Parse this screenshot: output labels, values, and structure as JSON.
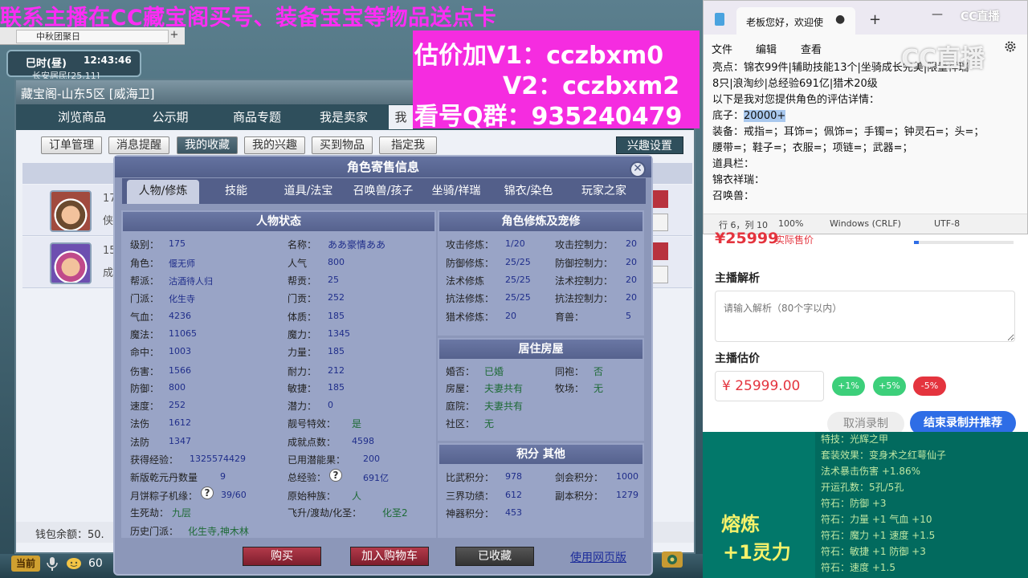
{
  "game": {
    "tab_title": "中秋团聚日",
    "time_label": "巳时(昼)",
    "time_value": "12:43:46",
    "location": "长安居民[25,11]",
    "window_title": "藏宝阁-山东5区 [威海卫]",
    "nav_tabs": [
      "浏览商品",
      "公示期",
      "商品专题",
      "我是卖家",
      "我"
    ],
    "sub_tabs": [
      "订单管理",
      "消息提醒",
      "我的收藏",
      "我的兴趣",
      "买到物品",
      "指定我"
    ],
    "interest_settings": "兴趣设置",
    "row1_snippet": "17",
    "row1_sub": "侠",
    "row2_snippet": "15",
    "row2_sub": "成",
    "wallet_label": "钱包余额：50.",
    "current_label": "当前",
    "level_num": "60"
  },
  "promo": {
    "line1": "联系主播在CC藏宝阁买号、装备宝宝等物品送点卡",
    "line2": "估价加V1：cczbxm0",
    "line3": "V2：cczbxm2",
    "line4": "看号Q群：935240479"
  },
  "modal": {
    "title": "角色寄售信息",
    "close": "✕",
    "tabs": [
      "人物/修炼",
      "技能",
      "道具/法宝",
      "召唤兽/孩子",
      "坐骑/祥瑞",
      "锦衣/染色",
      "玩家之家"
    ],
    "panel_status_title": "人物状态",
    "status_left": [
      {
        "label": "级别：",
        "value": "175"
      },
      {
        "label": "角色：",
        "value": "偃无师"
      },
      {
        "label": "帮派：",
        "value": "沽酒待人归"
      },
      {
        "label": "门派：",
        "value": "化生寺"
      },
      {
        "label": "气血：",
        "value": "4236"
      },
      {
        "label": "魔法：",
        "value": "11065"
      },
      {
        "label": "命中：",
        "value": "1003"
      },
      {
        "label": "伤害：",
        "value": "1566"
      },
      {
        "label": "防御：",
        "value": "800"
      },
      {
        "label": "速度：",
        "value": "252"
      },
      {
        "label": "法伤",
        "value": "1612"
      },
      {
        "label": "法防",
        "value": "1347"
      },
      {
        "label": "获得经验：",
        "value": "1325574429"
      },
      {
        "label": "新版乾元丹数量",
        "value": "9"
      },
      {
        "label": "月饼粽子机缘：",
        "value": "39/60"
      },
      {
        "label": "生死劫：",
        "value": "九层"
      },
      {
        "label": "历史门派：",
        "value": "化生寺,神木林"
      }
    ],
    "status_right": [
      {
        "label": "名称：",
        "value": "ああ豪情ああ"
      },
      {
        "label": "人气",
        "value": "800"
      },
      {
        "label": "帮贡：",
        "value": "25"
      },
      {
        "label": "门贡：",
        "value": "252"
      },
      {
        "label": "体质：",
        "value": "185"
      },
      {
        "label": "魔力：",
        "value": "1345"
      },
      {
        "label": "力量：",
        "value": "185"
      },
      {
        "label": "耐力：",
        "value": "212"
      },
      {
        "label": "敏捷：",
        "value": "185"
      },
      {
        "label": "潜力：",
        "value": "0"
      },
      {
        "label": "靓号特效：",
        "value": "是"
      },
      {
        "label": "成就点数：",
        "value": "4598"
      },
      {
        "label": "已用潜能果：",
        "value": "200"
      },
      {
        "label": "总经验：",
        "value": "691亿"
      },
      {
        "label": "原始种族：",
        "value": "人"
      },
      {
        "label": "飞升/渡劫/化圣：",
        "value": "化圣2"
      }
    ],
    "panel_cultivation_title": "角色修炼及宠修",
    "cultivation": [
      {
        "label": "攻击修炼：",
        "value": "1/20",
        "label2": "攻击控制力：",
        "value2": "20"
      },
      {
        "label": "防御修炼：",
        "value": "25/25",
        "label2": "防御控制力：",
        "value2": "20"
      },
      {
        "label": "法术修炼",
        "value": "25/25",
        "label2": "法术控制力：",
        "value2": "20"
      },
      {
        "label": "抗法修炼：",
        "value": "25/25",
        "label2": "抗法控制力：",
        "value2": "20"
      },
      {
        "label": "猎术修炼：",
        "value": "20",
        "label2": "育兽：",
        "value2": "5"
      }
    ],
    "panel_house_title": "居住房屋",
    "house": [
      {
        "label": "婚否：",
        "value": "已婚",
        "label2": "同袍：",
        "value2": "否"
      },
      {
        "label": "房屋：",
        "value": "夫妻共有",
        "label2": "牧场：",
        "value2": "无"
      },
      {
        "label": "庭院：",
        "value": "夫妻共有"
      },
      {
        "label": "社区：",
        "value": "无"
      }
    ],
    "panel_points_title": "积分 其他",
    "points": [
      {
        "label": "比武积分：",
        "value": "978",
        "label2": "剑会积分：",
        "value2": "1000"
      },
      {
        "label": "三界功绩：",
        "value": "612",
        "label2": "副本积分：",
        "value2": "1279"
      },
      {
        "label": "神器积分：",
        "value": "453"
      }
    ],
    "help_glyph": "?",
    "buttons": {
      "buy": "购买",
      "cart": "加入购物车",
      "collected": "已收藏",
      "web": "使用网页版"
    }
  },
  "notepad": {
    "tab_title": "老板您好，欢迎使",
    "tab_dot": "●",
    "add_tab": "+",
    "minimize": "—",
    "menus": [
      "文件",
      "编辑",
      "查看"
    ],
    "lines": [
      "亮点：锦衣99件|辅助技能13个|坐骑成长完美|限量祥瑞",
      "8只|浪淘纱|总经验691亿|猎术20级",
      "以下是我对您提供角色的评估详情：",
      "装备：戒指=；耳饰=；佩饰=；手镯=；钟灵石=；头=；",
      "腰带=；鞋子=；衣服=；项链=；武器=；",
      "道具栏：",
      "锦衣祥瑞：",
      "召唤兽："
    ],
    "base_label": "底子：",
    "base_value": "20000+",
    "status": {
      "position": "行 6，列 10",
      "zoom": "100%",
      "line_ending": "Windows (CRLF)",
      "encoding": "UTF-8"
    },
    "logo": "CC直播",
    "watermark": "CC直播"
  },
  "web": {
    "price": "¥25999",
    "price_note": "实际售价",
    "progress_fraction": 0.05,
    "analysis_heading": "主播解析",
    "analysis_placeholder": "请输入解析（80个字以内）",
    "estimate_heading": "主播估价",
    "estimate_value": "¥ 25999.00",
    "pct_buttons": [
      {
        "label": "+1%",
        "color": "#3ccf7a"
      },
      {
        "label": "+5%",
        "color": "#3ccf7a"
      },
      {
        "label": "-5%",
        "color": "#e4343e"
      }
    ],
    "cancel_button": "取消录制",
    "end_button": "结束录制并推荐"
  },
  "stats": {
    "refine_title": "熔炼",
    "refine_value": "+1灵力",
    "lines": [
      "特技：光辉之甲",
      "套装效果：变身术之红萼仙子",
      "法术暴击伤害 +1.86%",
      "开运孔数：5孔/5孔",
      "符石：防御 +3",
      "符石：力量 +1 气血 +10",
      "符石：魔力 +1 速度 +1.5",
      "符石：敏捷 +1 防御 +3",
      "符石：速度 +1.5"
    ]
  },
  "colors": {
    "promo_pink": "#ff2cf5",
    "accent_blue": "#2e6de6",
    "price_red": "#e4343e",
    "stats_green": "#02786a"
  }
}
